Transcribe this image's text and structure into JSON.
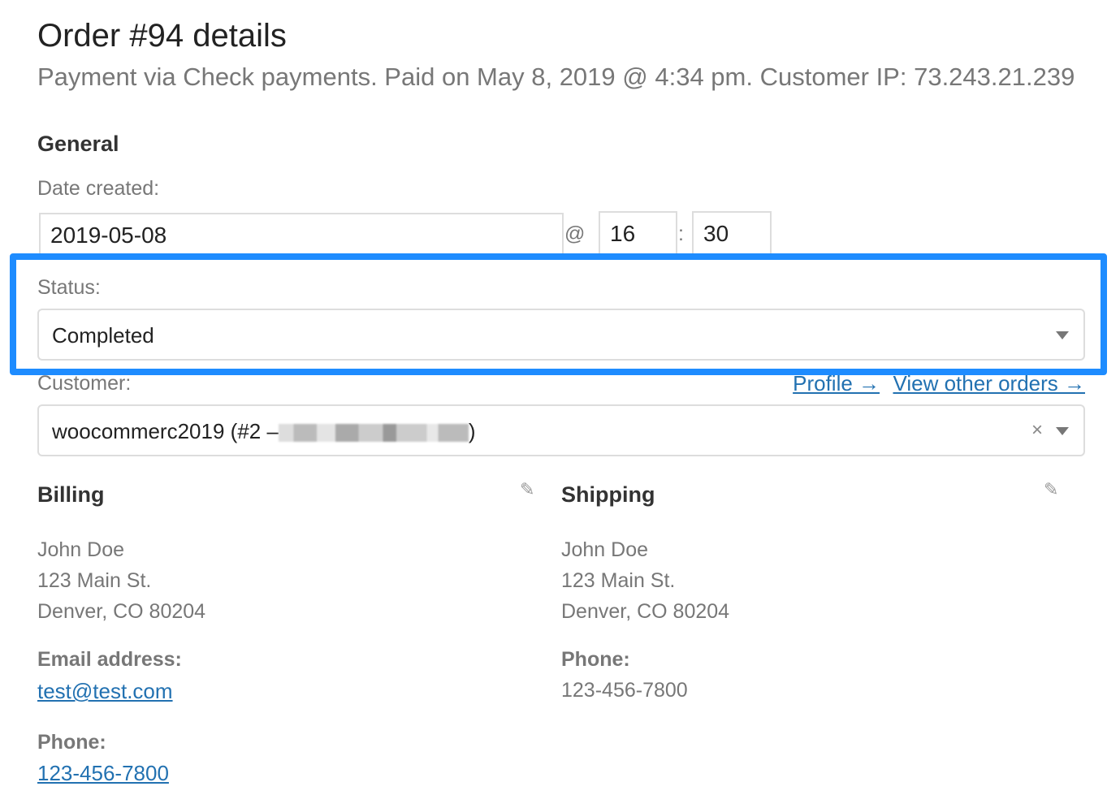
{
  "header": {
    "title": "Order #94 details",
    "subtitle": "Payment via Check payments. Paid on May 8, 2019 @ 4:34 pm. Customer IP: 73.243.21.239"
  },
  "general": {
    "heading": "General",
    "date_label": "Date created:",
    "date_value": "2019-05-08",
    "at": "@",
    "hour": "16",
    "colon": ":",
    "minute": "30",
    "status_label": "Status:",
    "status_value": "Completed",
    "customer_label": "Customer:",
    "profile_link": "Profile →",
    "other_orders_link": "View other orders →",
    "customer_value": "woocommerc2019 (#2 –",
    "customer_value_end": ")",
    "clear_symbol": "×"
  },
  "billing": {
    "heading": "Billing",
    "lines": [
      "John Doe",
      "123 Main St.",
      "Denver, CO 80204"
    ],
    "email_label": "Email address:",
    "email": "test@test.com",
    "phone_label": "Phone:",
    "phone": "123-456-7800"
  },
  "shipping": {
    "heading": "Shipping",
    "lines": [
      "John Doe",
      "123 Main St.",
      "Denver, CO 80204"
    ],
    "phone_label": "Phone:",
    "phone": "123-456-7800"
  },
  "colors": {
    "highlight": "#1e8cff",
    "link": "#2271b1"
  }
}
